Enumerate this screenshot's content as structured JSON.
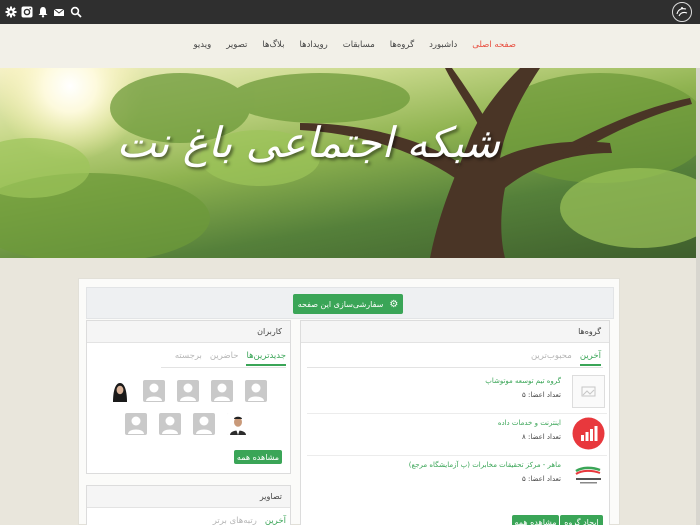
{
  "nav": {
    "items": [
      {
        "label": "صفحه اصلی",
        "active": true
      },
      {
        "label": "داشبورد"
      },
      {
        "label": "گروه‌ها"
      },
      {
        "label": "مسابقات"
      },
      {
        "label": "رویدادها"
      },
      {
        "label": "بلاگ‌ها"
      },
      {
        "label": "تصویر"
      },
      {
        "label": "ویدیو"
      }
    ]
  },
  "topbar": {
    "icons": [
      "search-icon",
      "mail-icon",
      "instagram-icon",
      "bell-icon",
      "settings-icon"
    ],
    "logo": "site-logo"
  },
  "banner": {
    "title": "شبکه اجتماعی باغ نت"
  },
  "customize": {
    "label": "سفارشی‌سازی این صفحه"
  },
  "groups": {
    "title": "گروه‌ها",
    "tabs": [
      {
        "label": "آخرین",
        "active": true
      },
      {
        "label": "محبوب‌ترین",
        "active": false
      }
    ],
    "items": [
      {
        "name": "گروه تیم توسعه موتوشاپ",
        "count": "تعداد اعضا: ۵",
        "thumb": "placeholder"
      },
      {
        "name": "اینترنت و خدمات داده",
        "count": "تعداد اعضا: ۸",
        "thumb": "chart"
      },
      {
        "name": "ماهر - مرکز تحقیقات مخابرات (پ آزمایشگاه مرجع)",
        "count": "تعداد اعضا: ۵",
        "thumb": "logo"
      }
    ],
    "create_label": "ایجاد گروه",
    "viewall_label": "مشاهده همه"
  },
  "users": {
    "title": "کاربران",
    "tabs": [
      {
        "label": "جدیدترین‌ها",
        "active": true
      },
      {
        "label": "حاضرین",
        "active": false
      },
      {
        "label": "برجسته",
        "active": false
      }
    ],
    "viewall_label": "مشاهده همه"
  },
  "pictures": {
    "title": "تصاویر",
    "tabs": [
      {
        "label": "آخرین",
        "active": true
      },
      {
        "label": "رتبه‌های برتر",
        "active": false
      }
    ]
  },
  "colors": {
    "accent": "#3aa557",
    "nav_active": "#e84c3d",
    "topbar": "#2f2f2f"
  }
}
